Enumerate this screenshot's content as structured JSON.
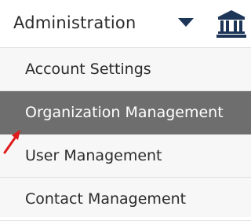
{
  "header": {
    "title": "Administration",
    "dropdown_icon": "caret-down-icon",
    "institution_icon": "bank-icon",
    "accent_color": "#1d3557"
  },
  "menu": {
    "items": [
      {
        "label": "Account Settings",
        "active": false
      },
      {
        "label": "Organization Management",
        "active": true
      },
      {
        "label": "User Management",
        "active": false
      },
      {
        "label": "Contact Management",
        "active": false
      }
    ],
    "active_background": "#6e6e6e"
  },
  "annotation": {
    "icon": "red-arrow-icon",
    "color": "#e01b1b"
  }
}
